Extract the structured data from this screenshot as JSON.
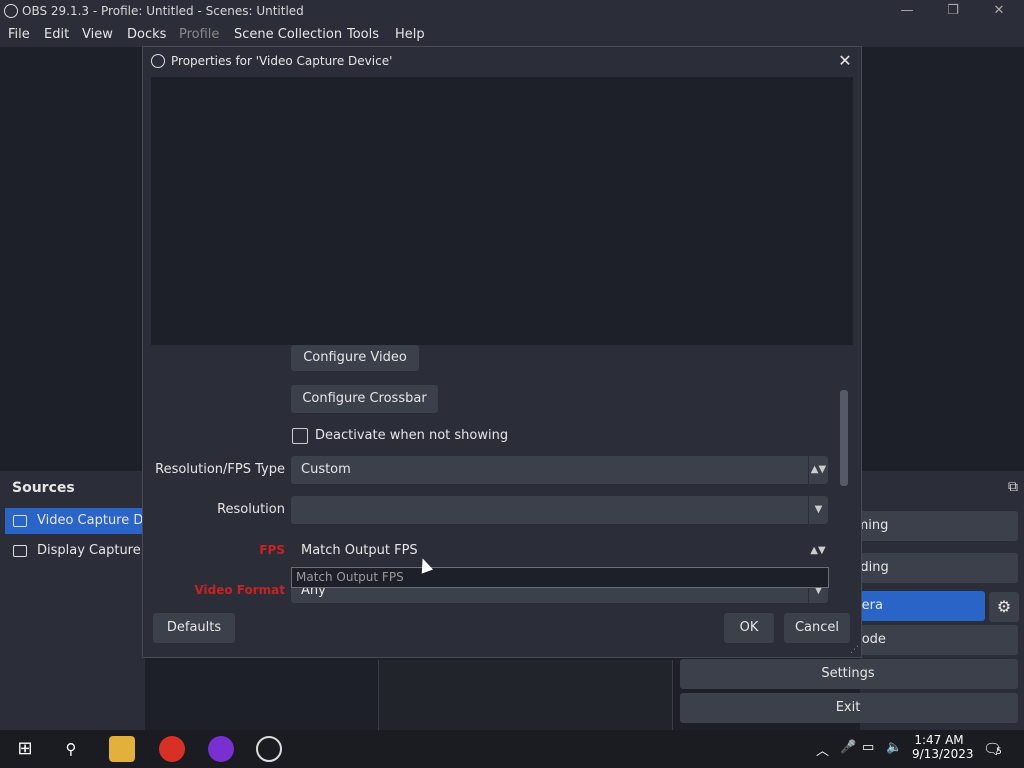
{
  "window": {
    "title": "OBS 29.1.3 - Profile: Untitled - Scenes: Untitled",
    "min": "—",
    "max": "❐",
    "close": "✕"
  },
  "menu": [
    "File",
    "Edit",
    "View",
    "Docks",
    "Profile",
    "Scene Collection",
    "Tools",
    "Help"
  ],
  "sources": {
    "header": "Sources",
    "items": [
      {
        "label": "Video Capture De",
        "selected": true
      },
      {
        "label": "Display Capture",
        "selected": false
      }
    ]
  },
  "controls": {
    "streaming": "aming",
    "recording": "ording",
    "virtualcam": "mera",
    "studio": "lode",
    "settings": "Settings",
    "exit": "Exit",
    "gear": "⚙",
    "dock_icon": "⧉"
  },
  "dialog": {
    "title": "Properties for 'Video Capture Device'",
    "close": "✕",
    "configure_video": "Configure Video",
    "configure_crossbar": "Configure Crossbar",
    "deactivate_label": "Deactivate when not showing",
    "resfps_label": "Resolution/FPS Type",
    "resfps_value": "Custom",
    "resolution_label": "Resolution",
    "resolution_value": "",
    "fps_label": "FPS",
    "fps_value": "Match Output FPS",
    "fps_dropdown_option": "Match Output FPS",
    "videoformat_label": "Video Format",
    "videoformat_value": "Any",
    "defaults": "Defaults",
    "ok": "OK",
    "cancel": "Cancel"
  },
  "taskbar": {
    "time": "1:47 AM",
    "date": "9/13/2023",
    "notif_count": "5"
  },
  "colors": {
    "accent": "#2a64c7",
    "error": "#c62323"
  }
}
